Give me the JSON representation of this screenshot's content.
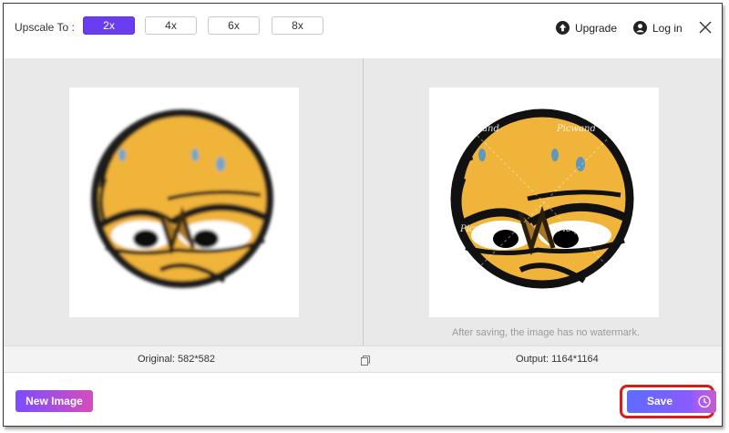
{
  "toolbar": {
    "upscale_label": "Upscale To :",
    "scale_options": [
      "2x",
      "4x",
      "6x",
      "8x"
    ],
    "selected_scale": "2x",
    "upgrade_label": "Upgrade",
    "login_label": "Log in",
    "upgrade_icon": "upgrade-icon",
    "login_icon": "user-icon",
    "close_icon": "close-icon"
  },
  "compare": {
    "watermark_text": "Picwand",
    "watermark_note": "After saving, the image has no watermark."
  },
  "info": {
    "original_label": "Original: 582*582",
    "output_label": "Output: 1164*1164",
    "compare_icon": "copy-icon"
  },
  "footer": {
    "new_image_label": "New Image",
    "save_label": "Save",
    "clock_icon": "clock-icon"
  },
  "colors": {
    "accent": "#6a3df0",
    "highlight": "#d81b1b",
    "emoji_face": "#f0b43a"
  }
}
